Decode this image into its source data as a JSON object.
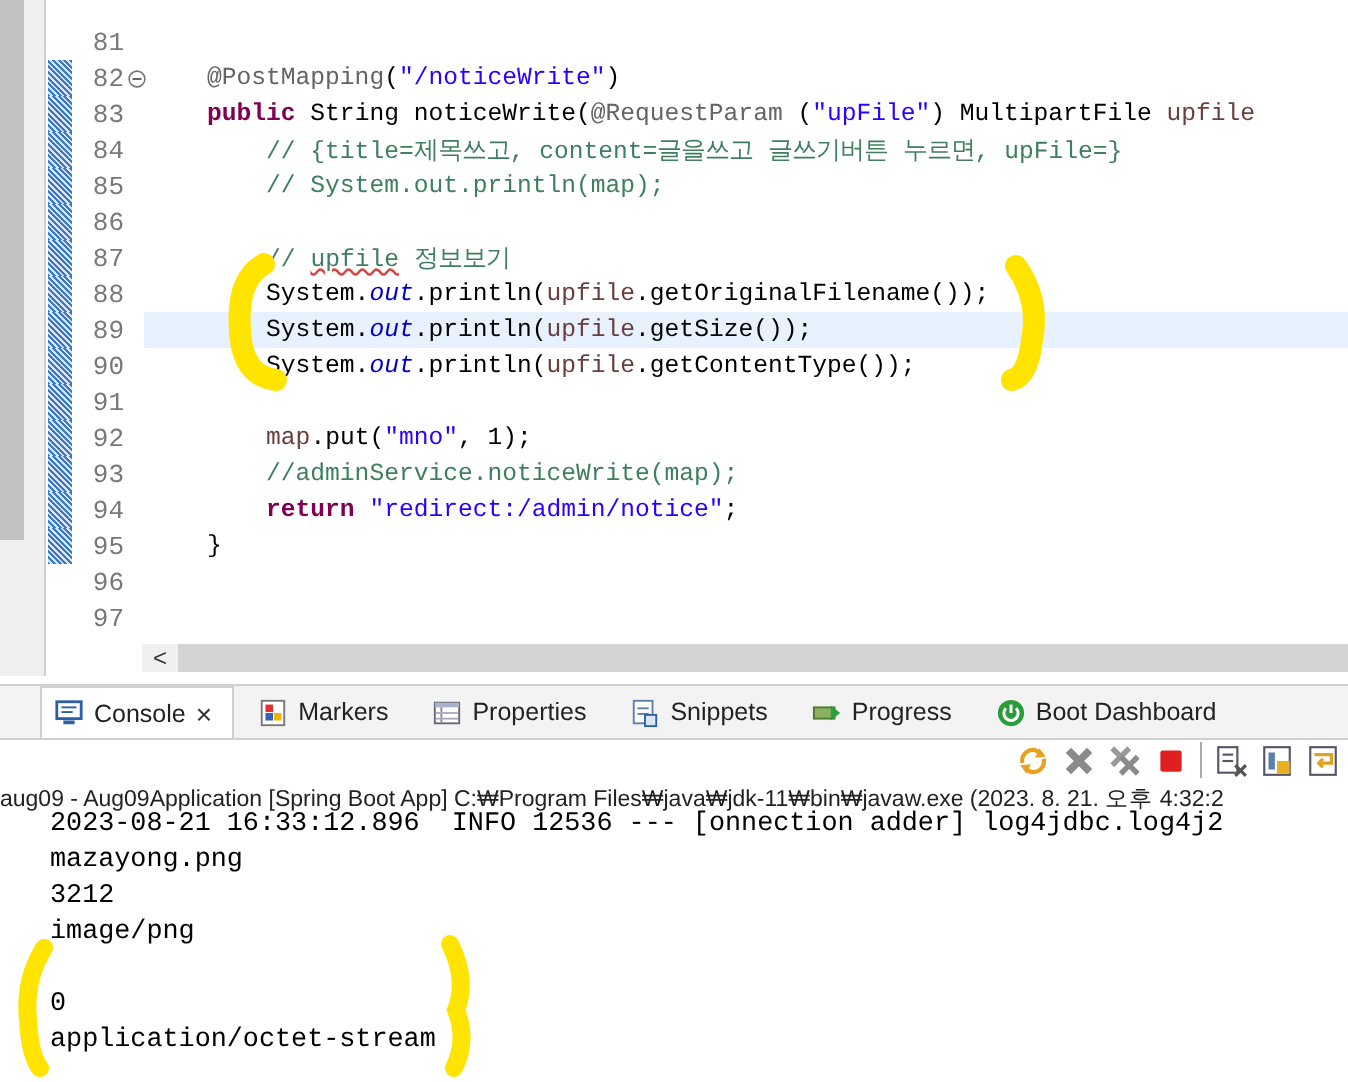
{
  "editor": {
    "lines": [
      {
        "number": "81",
        "current": false,
        "changed": false,
        "fold_marker": false
      },
      {
        "number": "82",
        "current": false,
        "changed": true,
        "fold_marker": true,
        "segments": [
          {
            "kind": "anno",
            "text": "    @PostMapping"
          },
          {
            "kind": "plain",
            "text": "("
          },
          {
            "kind": "str",
            "text": "\"/noticeWrite\""
          },
          {
            "kind": "plain",
            "text": ")"
          }
        ]
      },
      {
        "number": "83",
        "current": false,
        "changed": true,
        "fold_marker": false,
        "segments": [
          {
            "kind": "kw",
            "text": "    public"
          },
          {
            "kind": "plain",
            "text": " String noticeWrite("
          },
          {
            "kind": "anno",
            "text": "@RequestParam"
          },
          {
            "kind": "plain",
            "text": " ("
          },
          {
            "kind": "str",
            "text": "\"upFile\""
          },
          {
            "kind": "plain",
            "text": ") MultipartFile "
          },
          {
            "kind": "var",
            "text": "upfile"
          }
        ]
      },
      {
        "number": "84",
        "current": false,
        "changed": true,
        "fold_marker": false,
        "segments": [
          {
            "kind": "comment",
            "text": "        // {title=제목쓰고, content=글을쓰고 글쓰기버튼 누르면, upFile=}"
          }
        ]
      },
      {
        "number": "85",
        "current": false,
        "changed": true,
        "fold_marker": false,
        "segments": [
          {
            "kind": "comment",
            "text": "        // System.out.println(map);"
          }
        ]
      },
      {
        "number": "86",
        "current": false,
        "changed": true,
        "fold_marker": false
      },
      {
        "number": "87",
        "current": false,
        "changed": true,
        "fold_marker": false,
        "segments": [
          {
            "kind": "comment",
            "text": "        // "
          },
          {
            "kind": "comment-typo",
            "text": "upfile"
          },
          {
            "kind": "comment",
            "text": " 정보보기"
          }
        ]
      },
      {
        "number": "88",
        "current": false,
        "changed": true,
        "fold_marker": false,
        "segments": [
          {
            "kind": "plain",
            "text": "        System."
          },
          {
            "kind": "static",
            "text": "out"
          },
          {
            "kind": "plain",
            "text": ".println("
          },
          {
            "kind": "var",
            "text": "upfile"
          },
          {
            "kind": "plain",
            "text": ".getOriginalFilename());"
          }
        ]
      },
      {
        "number": "89",
        "current": true,
        "changed": true,
        "fold_marker": false,
        "segments": [
          {
            "kind": "plain",
            "text": "        System."
          },
          {
            "kind": "static",
            "text": "out"
          },
          {
            "kind": "plain",
            "text": ".println("
          },
          {
            "kind": "var",
            "text": "upfile"
          },
          {
            "kind": "plain",
            "text": ".getSize());"
          }
        ]
      },
      {
        "number": "90",
        "current": false,
        "changed": true,
        "fold_marker": false,
        "segments": [
          {
            "kind": "plain",
            "text": "        System."
          },
          {
            "kind": "static",
            "text": "out"
          },
          {
            "kind": "plain",
            "text": ".println("
          },
          {
            "kind": "var",
            "text": "upfile"
          },
          {
            "kind": "plain",
            "text": ".getContentType());"
          }
        ]
      },
      {
        "number": "91",
        "current": false,
        "changed": true,
        "fold_marker": false
      },
      {
        "number": "92",
        "current": false,
        "changed": true,
        "fold_marker": false,
        "segments": [
          {
            "kind": "var",
            "text": "        map"
          },
          {
            "kind": "plain",
            "text": ".put("
          },
          {
            "kind": "str",
            "text": "\"mno\""
          },
          {
            "kind": "plain",
            "text": ", 1);"
          }
        ]
      },
      {
        "number": "93",
        "current": false,
        "changed": true,
        "fold_marker": false,
        "segments": [
          {
            "kind": "comment",
            "text": "        //adminService.noticeWrite(map);"
          }
        ]
      },
      {
        "number": "94",
        "current": false,
        "changed": true,
        "fold_marker": false,
        "segments": [
          {
            "kind": "kw",
            "text": "        return"
          },
          {
            "kind": "str",
            "text": " \"redirect:/admin/notice\""
          },
          {
            "kind": "plain",
            "text": ";"
          }
        ]
      },
      {
        "number": "95",
        "current": false,
        "changed": true,
        "fold_marker": false,
        "segments": [
          {
            "kind": "plain",
            "text": "    }"
          }
        ]
      },
      {
        "number": "96",
        "current": false,
        "changed": false,
        "fold_marker": false
      },
      {
        "number": "97",
        "current": false,
        "changed": false,
        "fold_marker": false
      }
    ],
    "scroll_left": "<"
  },
  "panel": {
    "tabs": [
      {
        "label": "Console",
        "selected": true,
        "close": "×"
      },
      {
        "label": "Markers",
        "selected": false
      },
      {
        "label": "Properties",
        "selected": false
      },
      {
        "label": "Snippets",
        "selected": false
      },
      {
        "label": "Progress",
        "selected": false
      },
      {
        "label": "Boot Dashboard",
        "selected": false
      }
    ],
    "process": "aug09 - Aug09Application [Spring Boot App] C:₩Program Files₩java₩jdk-11₩bin₩javaw.exe  (2023. 8. 21. 오후 4:32:2",
    "console": [
      {
        "kind": "text",
        "text": "2023-08-21 16:33:12.896  INFO 12536 --- [onnection adder] log4jdbc.log4j2"
      },
      {
        "kind": "text",
        "text": "mazayong.png"
      },
      {
        "kind": "text",
        "text": "3212"
      },
      {
        "kind": "text",
        "text": "image/png"
      },
      {
        "kind": "blank"
      },
      {
        "kind": "text",
        "text": "0"
      },
      {
        "kind": "text",
        "text": "application/octet-stream"
      }
    ]
  }
}
